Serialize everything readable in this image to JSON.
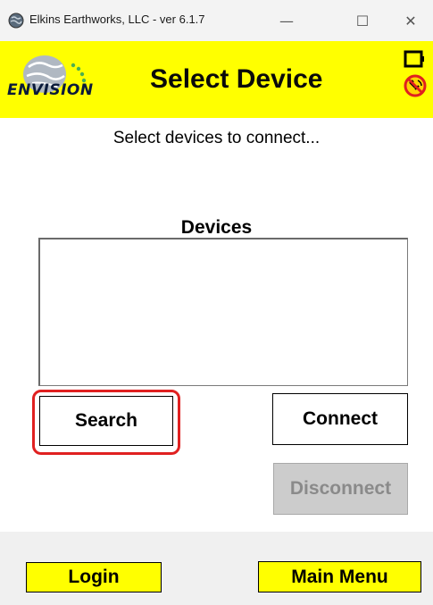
{
  "window": {
    "title": "Elkins Earthworks, LLC - ver 6.1.7",
    "controls": {
      "minimize": "—",
      "maximize": "☐",
      "close": "✕"
    }
  },
  "header": {
    "logo_text": "ENVISION",
    "title": "Select Device",
    "background_color": "#ffff00",
    "status_icons": [
      "battery-icon",
      "gps-disconnected-icon"
    ]
  },
  "main": {
    "instruction": "Select devices to connect...",
    "devices_label": "Devices",
    "devices": []
  },
  "buttons": {
    "search": "Search",
    "connect": "Connect",
    "disconnect": "Disconnect",
    "disconnect_enabled": false,
    "highlight_color": "#e02020"
  },
  "footer": {
    "login": "Login",
    "main_menu": "Main Menu"
  }
}
